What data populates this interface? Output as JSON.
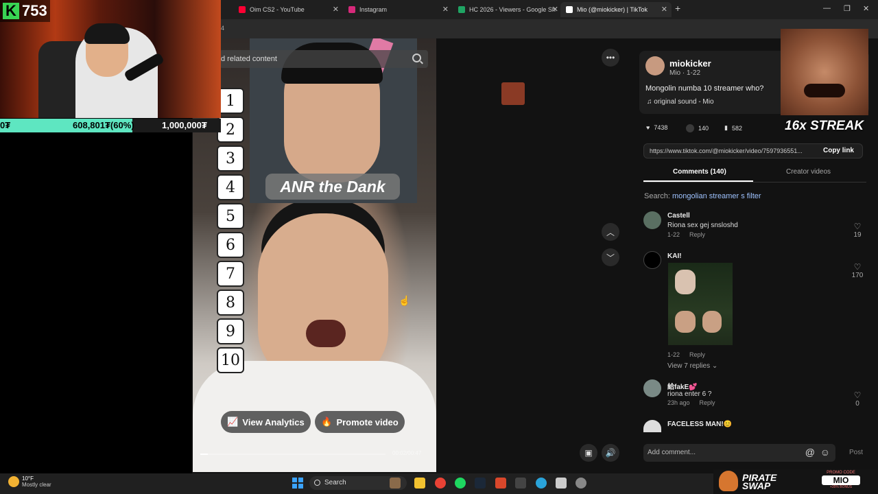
{
  "stream": {
    "kick_badge_letter": "K",
    "viewer_count": "753",
    "goal_left": "0₮",
    "goal_progress": "608,801₮(60%)",
    "goal_target": "1,000,000₮",
    "goal_fraction": 0.6
  },
  "browser": {
    "tabs": [
      {
        "label": "Oim CS2 - YouTube",
        "icon": "youtube-icon",
        "color": "#ff0033"
      },
      {
        "label": "Instagram",
        "icon": "instagram-icon",
        "color": "#d6297a"
      },
      {
        "label": "HC 2026 - Viewers - Google Sh",
        "icon": "sheets-icon",
        "color": "#1fa463"
      },
      {
        "label": "Mio (@miokicker) | TikTok",
        "icon": "tiktok-icon",
        "color": "#ffffff"
      }
    ],
    "new_tab": "+",
    "zoom_fragment": "4"
  },
  "video": {
    "search_text": "d related content",
    "overlay_title": "ANR the Dank",
    "rank_labels": [
      "1",
      "2",
      "3",
      "4",
      "5",
      "6",
      "7",
      "8",
      "9",
      "10"
    ],
    "view_analytics": "View Analytics",
    "promote_video": "Promote video",
    "timecode": "00:02/00:47",
    "progress_fraction": 0.04
  },
  "post": {
    "username": "miokicker",
    "meta": "Mio · 1-22",
    "caption": "Mongolin numba 10 streamer who?",
    "sound": "original sound - Mio",
    "likes": "7438",
    "comments": "140",
    "saves": "582",
    "streak": "16x STREAK",
    "url": "https://www.tiktok.com/@miokicker/video/7597936551...",
    "copy_link": "Copy link",
    "tab_comments": "Comments (140)",
    "tab_creator": "Creator videos",
    "search_label": "Search:",
    "search_query": "mongolian streamer s filter"
  },
  "comments": [
    {
      "name": "Castell",
      "text": "Riona sex gej snsloshd",
      "date": "1-22",
      "reply": "Reply",
      "likes": "19"
    },
    {
      "name": "KAI!",
      "text": "",
      "date": "1-22",
      "reply": "Reply",
      "likes": "170",
      "view_replies": "View 7 replies"
    },
    {
      "name": "給fakE💕",
      "text": "riona enter 6 ?",
      "date": "23h ago",
      "reply": "Reply",
      "likes": "0"
    },
    {
      "name": "FACELESS MAN!😊",
      "text": "",
      "date": "",
      "reply": "",
      "likes": ""
    }
  ],
  "composer": {
    "placeholder": "Add comment...",
    "at": "@",
    "emoji": "☺",
    "post": "Post"
  },
  "taskbar": {
    "temp": "10°F",
    "weather": "Mostly clear",
    "search": "Search"
  },
  "ad": {
    "brand_line1": "PIRATE",
    "brand_line2": "SWAP",
    "promo_label": "PROMO CODE",
    "promo_code": "MIO",
    "bonus": "+35% BONUS"
  }
}
